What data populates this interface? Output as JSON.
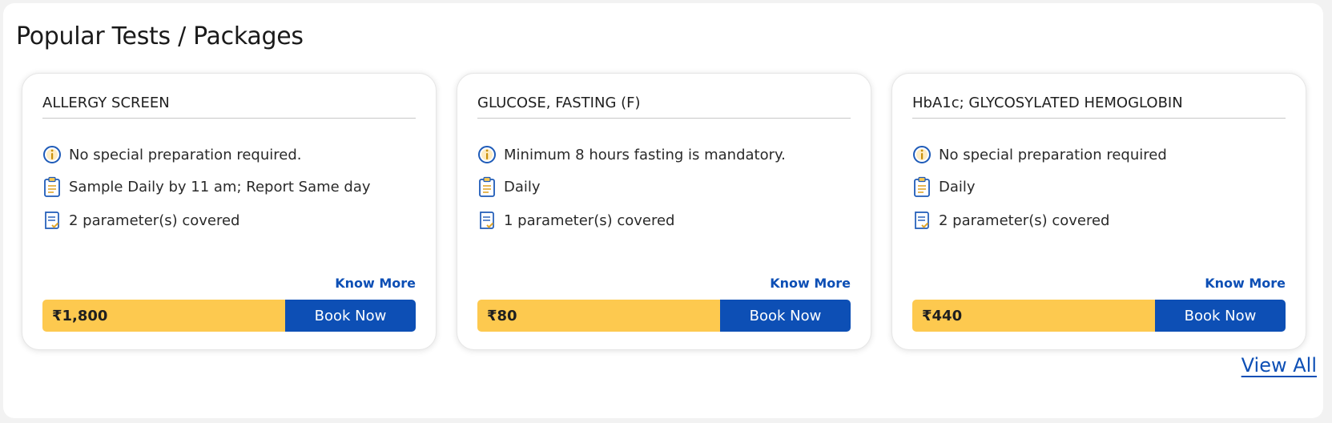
{
  "section": {
    "title": "Popular Tests / Packages",
    "view_all": "View All"
  },
  "colors": {
    "accent": "#0d4fb5",
    "price_bg": "#fdc94f",
    "text": "#222222"
  },
  "cards": [
    {
      "title": "ALLERGY SCREEN",
      "preparation": "No special preparation required.",
      "schedule": "Sample Daily by 11 am; Report Same day",
      "parameters": "2 parameter(s) covered",
      "know_more": "Know More",
      "price": "₹1,800",
      "book_label": "Book Now"
    },
    {
      "title": "GLUCOSE, FASTING (F)",
      "preparation": "Minimum 8 hours fasting is mandatory.",
      "schedule": "Daily",
      "parameters": "1 parameter(s) covered",
      "know_more": "Know More",
      "price": "₹80",
      "book_label": "Book Now"
    },
    {
      "title": "HbA1c; GLYCOSYLATED HEMOGLOBIN",
      "preparation": "No special preparation required",
      "schedule": "Daily",
      "parameters": "2 parameter(s) covered",
      "know_more": "Know More",
      "price": "₹440",
      "book_label": "Book Now"
    }
  ],
  "icons": {
    "preparation": "info-icon",
    "schedule": "clipboard-icon",
    "parameters": "checklist-icon"
  }
}
